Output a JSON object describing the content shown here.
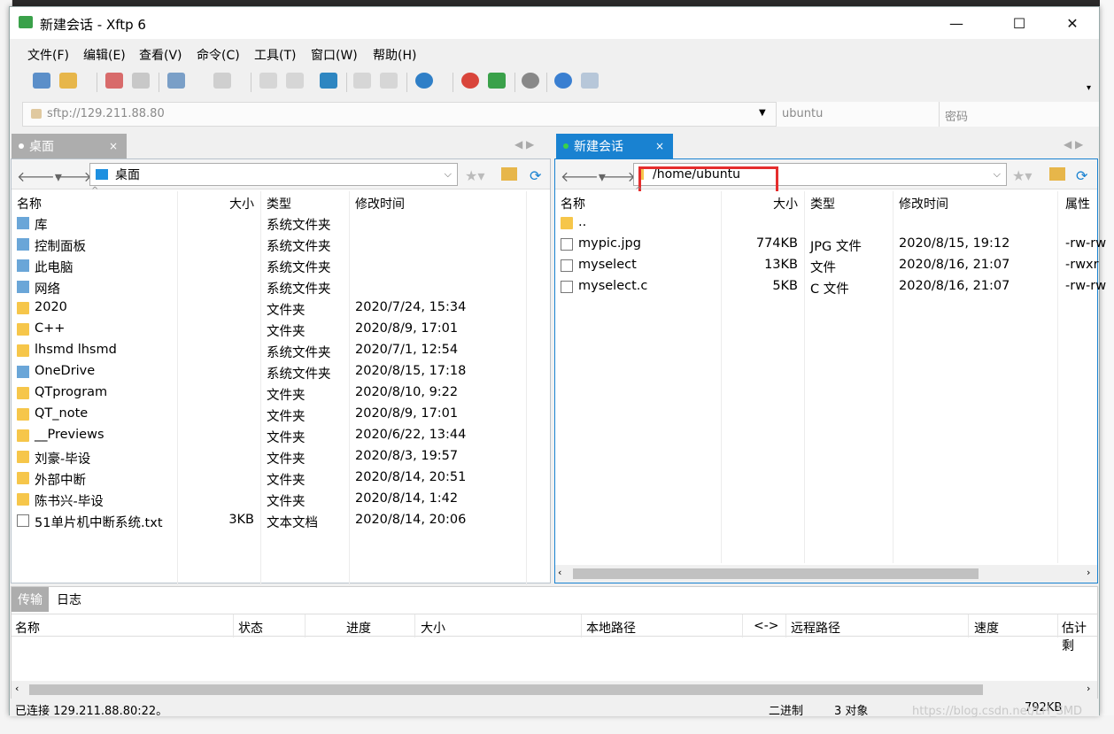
{
  "window": {
    "title": "新建会话 - Xftp 6",
    "controls": [
      "—",
      "☐",
      "✕"
    ]
  },
  "menu": [
    "文件(F)",
    "编辑(E)",
    "查看(V)",
    "命令(C)",
    "工具(T)",
    "窗口(W)",
    "帮助(H)"
  ],
  "address": {
    "url": "sftp://129.211.88.80",
    "username_placeholder": "ubuntu",
    "password_placeholder": "密码"
  },
  "left_tab": {
    "label": "桌面",
    "close": "×"
  },
  "right_tab": {
    "label": "新建会话",
    "close": "×"
  },
  "left_pane": {
    "path": "桌面",
    "headers": [
      "名称",
      "大小",
      "类型",
      "修改时间"
    ],
    "rows": [
      {
        "name": "库",
        "size": "",
        "type": "系统文件夹",
        "modified": "",
        "icon": "library-icon"
      },
      {
        "name": "控制面板",
        "size": "",
        "type": "系统文件夹",
        "modified": "",
        "icon": "control-panel-icon"
      },
      {
        "name": "此电脑",
        "size": "",
        "type": "系统文件夹",
        "modified": "",
        "icon": "computer-icon"
      },
      {
        "name": "网络",
        "size": "",
        "type": "系统文件夹",
        "modified": "",
        "icon": "network-icon"
      },
      {
        "name": "2020",
        "size": "",
        "type": "文件夹",
        "modified": "2020/7/24, 15:34",
        "icon": "folder-icon"
      },
      {
        "name": "C++",
        "size": "",
        "type": "文件夹",
        "modified": "2020/8/9, 17:01",
        "icon": "folder-icon"
      },
      {
        "name": "lhsmd lhsmd",
        "size": "",
        "type": "系统文件夹",
        "modified": "2020/7/1, 12:54",
        "icon": "user-folder-icon"
      },
      {
        "name": "OneDrive",
        "size": "",
        "type": "系统文件夹",
        "modified": "2020/8/15, 17:18",
        "icon": "cloud-icon"
      },
      {
        "name": "QTprogram",
        "size": "",
        "type": "文件夹",
        "modified": "2020/8/10, 9:22",
        "icon": "folder-icon"
      },
      {
        "name": "QT_note",
        "size": "",
        "type": "文件夹",
        "modified": "2020/8/9, 17:01",
        "icon": "folder-icon"
      },
      {
        "name": "__Previews",
        "size": "",
        "type": "文件夹",
        "modified": "2020/6/22, 13:44",
        "icon": "folder-icon"
      },
      {
        "name": "刘豪-毕设",
        "size": "",
        "type": "文件夹",
        "modified": "2020/8/3, 19:57",
        "icon": "folder-icon"
      },
      {
        "name": "外部中断",
        "size": "",
        "type": "文件夹",
        "modified": "2020/8/14, 20:51",
        "icon": "folder-icon"
      },
      {
        "name": "陈书兴-毕设",
        "size": "",
        "type": "文件夹",
        "modified": "2020/8/14, 1:42",
        "icon": "folder-icon"
      },
      {
        "name": "51单片机中断系统.txt",
        "size": "3KB",
        "type": "文本文档",
        "modified": "2020/8/14, 20:06",
        "icon": "text-file-icon"
      }
    ]
  },
  "right_pane": {
    "path": "/home/ubuntu",
    "headers": [
      "名称",
      "大小",
      "类型",
      "修改时间",
      "属性"
    ],
    "rows": [
      {
        "name": "..",
        "size": "",
        "type": "",
        "modified": "",
        "attr": "",
        "icon": "folder-icon"
      },
      {
        "name": "mypic.jpg",
        "size": "774KB",
        "type": "JPG 文件",
        "modified": "2020/8/15, 19:12",
        "attr": "-rw-rw",
        "icon": "image-file-icon"
      },
      {
        "name": "myselect",
        "size": "13KB",
        "type": "文件",
        "modified": "2020/8/16, 21:07",
        "attr": "-rwxr",
        "icon": "file-icon"
      },
      {
        "name": "myselect.c",
        "size": "5KB",
        "type": "C 文件",
        "modified": "2020/8/16, 21:07",
        "attr": "-rw-rw",
        "icon": "file-icon"
      }
    ]
  },
  "bottom": {
    "tabs": [
      "传输",
      "日志"
    ],
    "headers": [
      "名称",
      "状态",
      "进度",
      "大小",
      "本地路径",
      "<->",
      "远程路径",
      "速度",
      "估计剩"
    ]
  },
  "status": {
    "connection": "已连接 129.211.88.80:22。",
    "mode": "二进制",
    "objects": "3 对象",
    "size": "792KB"
  },
  "watermark": "https://blog.csdn.net/LH_SMD",
  "colors": {
    "accent": "#1982d1",
    "highlight": "#e52d2d",
    "folder": "#f6c64a"
  }
}
